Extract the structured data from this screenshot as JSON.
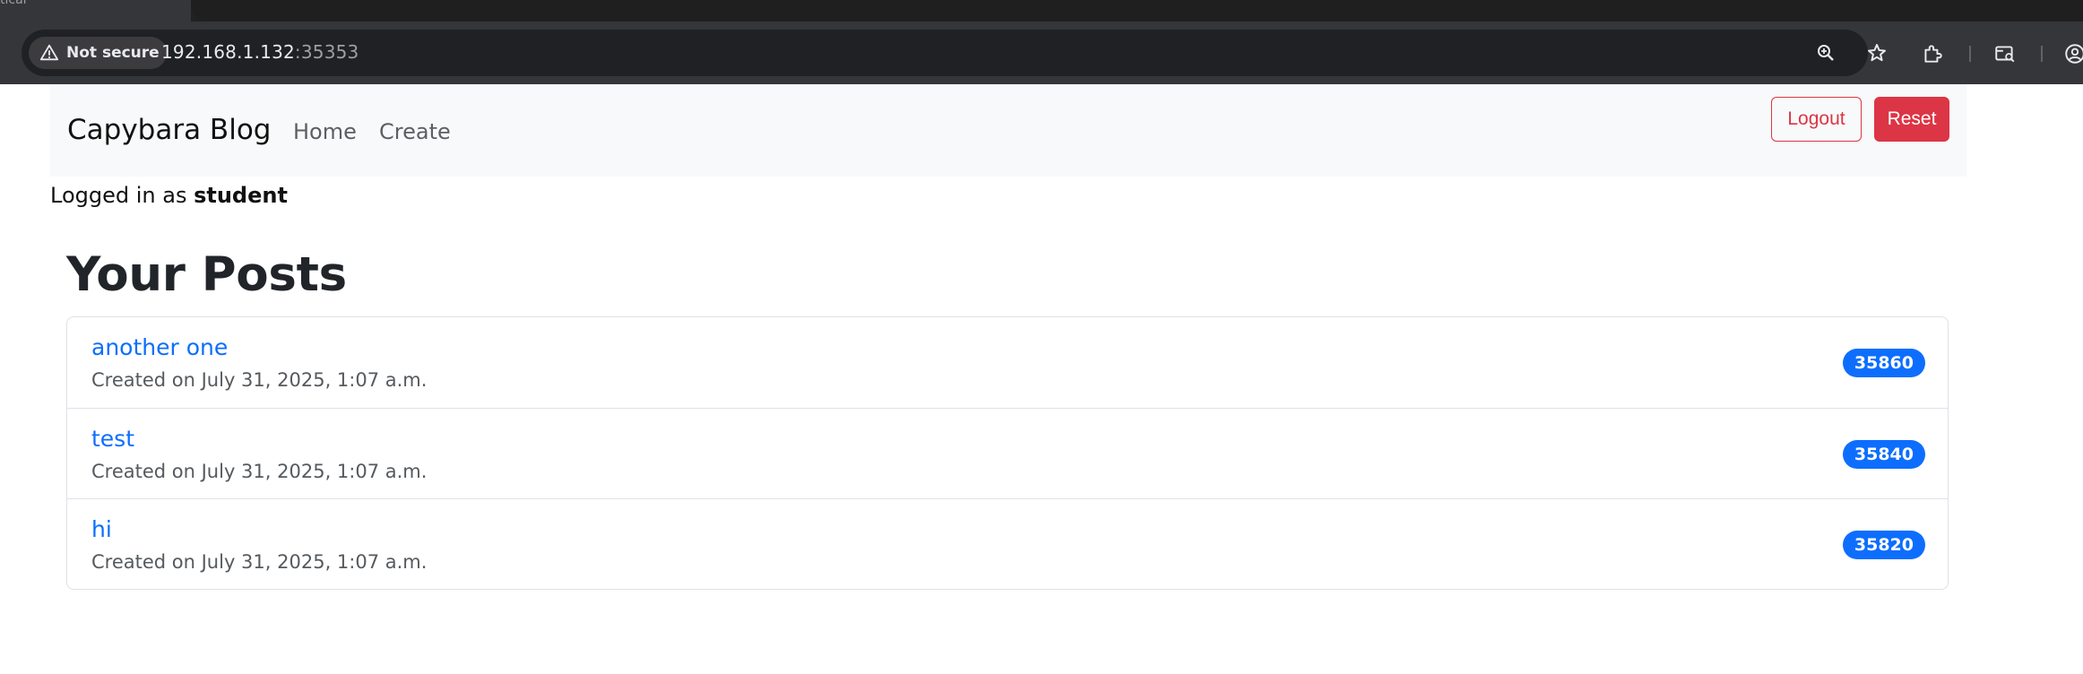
{
  "browser": {
    "tab_fragment": "tical",
    "security_label": "Not secure",
    "url_host": "192.168.1.132",
    "url_port": ":35353",
    "icons": [
      "warning-icon",
      "zoom-icon",
      "bookmark-star-icon",
      "extensions-icon",
      "tab-search-icon",
      "profile-icon"
    ]
  },
  "navbar": {
    "brand": "Capybara Blog",
    "links": [
      {
        "label": "Home"
      },
      {
        "label": "Create"
      }
    ],
    "logout_label": "Logout",
    "reset_label": "Reset"
  },
  "session": {
    "prefix": "Logged in as ",
    "username": "student"
  },
  "page_title": "Your Posts",
  "posts": [
    {
      "title": "another one",
      "meta": "Created on July 31, 2025, 1:07 a.m.",
      "badge": "35860"
    },
    {
      "title": "test",
      "meta": "Created on July 31, 2025, 1:07 a.m.",
      "badge": "35840"
    },
    {
      "title": "hi",
      "meta": "Created on July 31, 2025, 1:07 a.m.",
      "badge": "35820"
    }
  ],
  "colors": {
    "primary": "#0d6efd",
    "danger": "#dc3545",
    "navbar_bg": "#f8f9fa",
    "chrome_bg": "#35363a"
  }
}
